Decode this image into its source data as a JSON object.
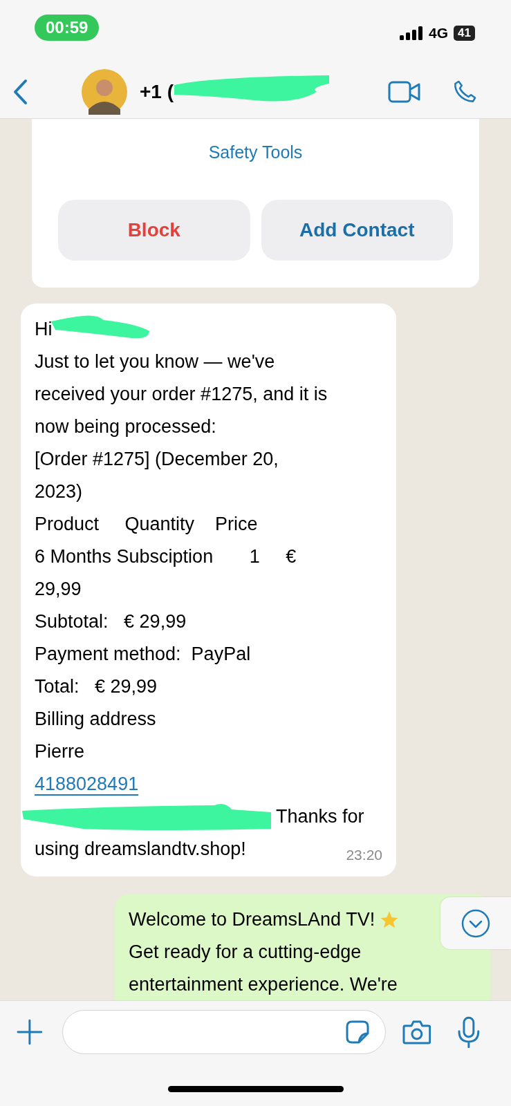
{
  "status_bar": {
    "time": "00:59",
    "network": "4G",
    "battery": "41"
  },
  "header": {
    "contact_visible": "+1 ("
  },
  "safety_card": {
    "title": "Safety Tools",
    "buttons": [
      {
        "label": "Block",
        "kind": "danger"
      },
      {
        "label": "Add Contact",
        "kind": "primary"
      }
    ]
  },
  "messages": [
    {
      "outgoing": false,
      "lines": [
        {
          "kind": "redacted",
          "text": "Hi"
        },
        {
          "kind": "text",
          "text": "Just to let you know — we've"
        },
        {
          "kind": "text",
          "text": "received your order #1275, and it is"
        },
        {
          "kind": "text",
          "text": "now being processed:"
        },
        {
          "kind": "text",
          "text": "[Order #1275] (December 20,"
        },
        {
          "kind": "text",
          "text": "2023)"
        },
        {
          "kind": "text",
          "text": "Product     Quantity    Price"
        },
        {
          "kind": "text",
          "text": "6 Months Subsciption       1     €"
        },
        {
          "kind": "text",
          "text": "29,99"
        },
        {
          "kind": "text",
          "text": "Subtotal:   € 29,99"
        },
        {
          "kind": "text",
          "text": "Payment method:  PayPal"
        },
        {
          "kind": "text",
          "text": "Total:   € 29,99"
        },
        {
          "kind": "text",
          "text": "Billing address"
        },
        {
          "kind": "text",
          "text": "Pierre"
        },
        {
          "kind": "link",
          "text": "4188028491"
        },
        {
          "kind": "redacted-link",
          "text": "Thanks for"
        },
        {
          "kind": "text",
          "text": "using dreamslandtv.shop!"
        }
      ],
      "time": "23:20"
    },
    {
      "outgoing": true,
      "lines": [
        {
          "kind": "emoji",
          "text": "Welcome to DreamsLAnd TV!"
        },
        {
          "kind": "text",
          "text": "Get ready for a cutting-edge"
        },
        {
          "kind": "text",
          "text": "entertainment experience. We're"
        }
      ]
    }
  ]
}
